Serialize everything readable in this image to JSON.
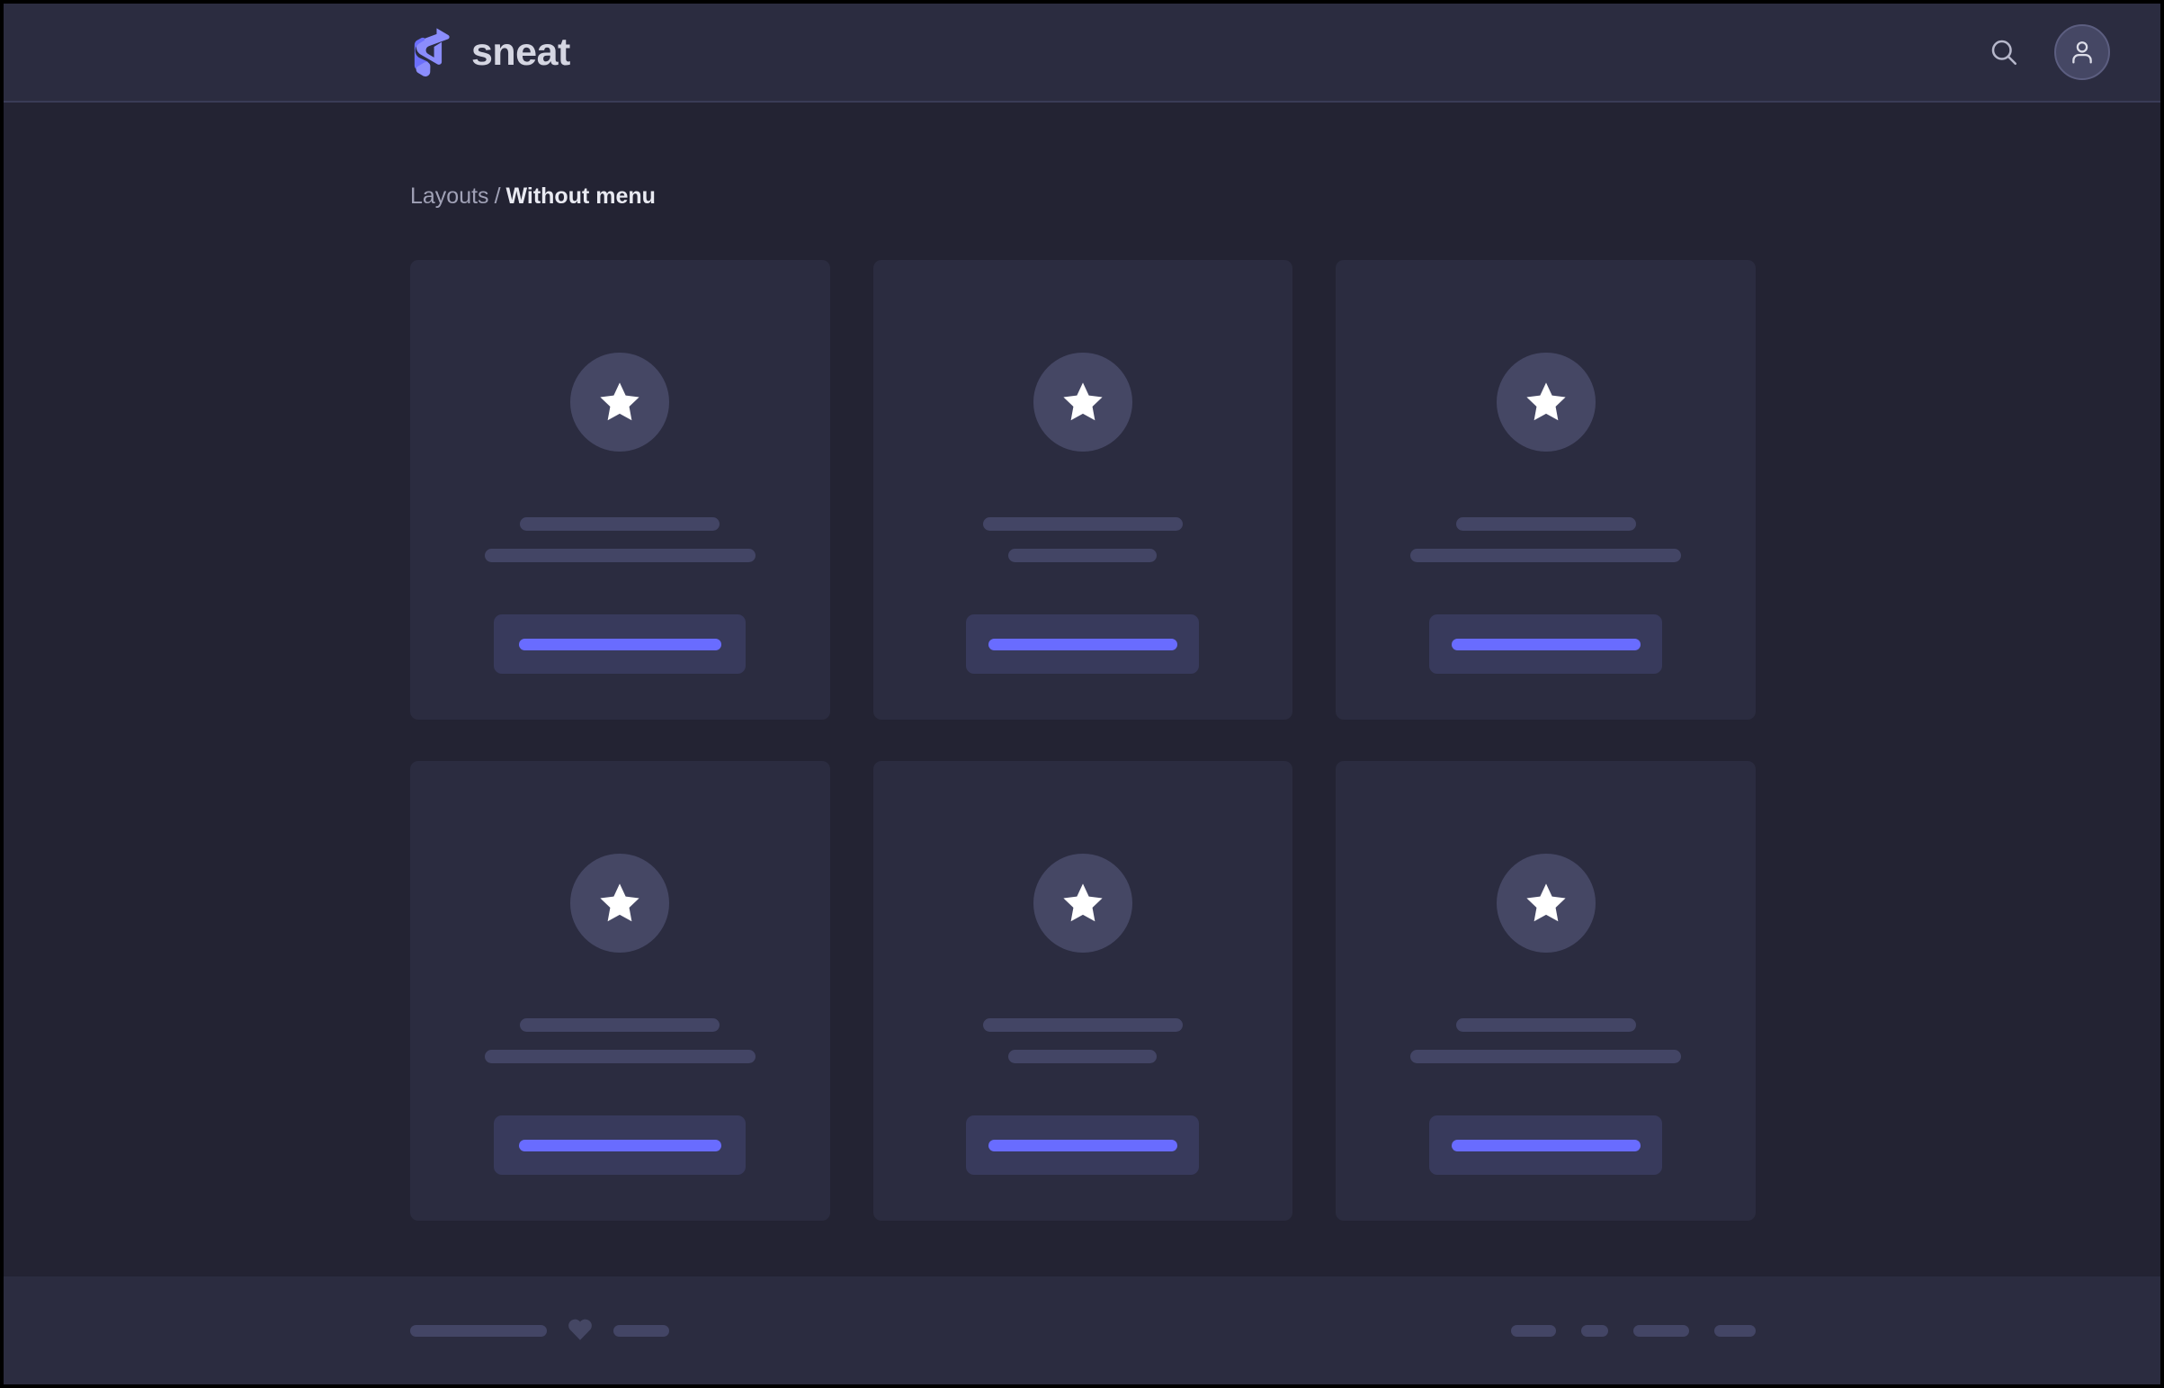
{
  "header": {
    "brand_name": "sneat",
    "logo_icon": "sneat-s-logo",
    "search_icon": "search-icon",
    "avatar_icon": "user-avatar-icon",
    "bg_color": "#2b2c40",
    "brand_color": "#696cff"
  },
  "breadcrumb": {
    "parent": "Layouts",
    "separator": "/",
    "active": "Without menu"
  },
  "page": {
    "body_bg": "#232333",
    "card_bg": "#2b2c40",
    "placeholder_color": "#434565",
    "accent_color": "#696cff",
    "icon_circle_color": "#454764"
  },
  "cards": [
    {
      "icon": "star-icon",
      "line_1_width": 148,
      "line_2_width": 200,
      "button_width": 186,
      "button_bar_width": 150
    },
    {
      "icon": "star-icon",
      "line_1_width": 148,
      "line_2_width": 110,
      "button_width": 172,
      "button_bar_width": 140
    },
    {
      "icon": "star-icon",
      "line_1_width": 133,
      "line_2_width": 200,
      "button_width": 172,
      "button_bar_width": 140
    },
    {
      "icon": "star-icon",
      "line_1_width": 148,
      "line_2_width": 200,
      "button_width": 186,
      "button_bar_width": 150
    },
    {
      "icon": "star-icon",
      "line_1_width": 148,
      "line_2_width": 110,
      "button_width": 172,
      "button_bar_width": 140
    },
    {
      "icon": "star-icon",
      "line_1_width": 133,
      "line_2_width": 200,
      "button_width": 172,
      "button_bar_width": 140
    }
  ],
  "footer": {
    "bg_color": "#2b2c40",
    "left_bar_1_width": 152,
    "heart_icon": "heart-icon",
    "left_bar_2_width": 62,
    "links": [
      {
        "width": 50
      },
      {
        "width": 30
      },
      {
        "width": 62
      },
      {
        "width": 46
      }
    ]
  }
}
